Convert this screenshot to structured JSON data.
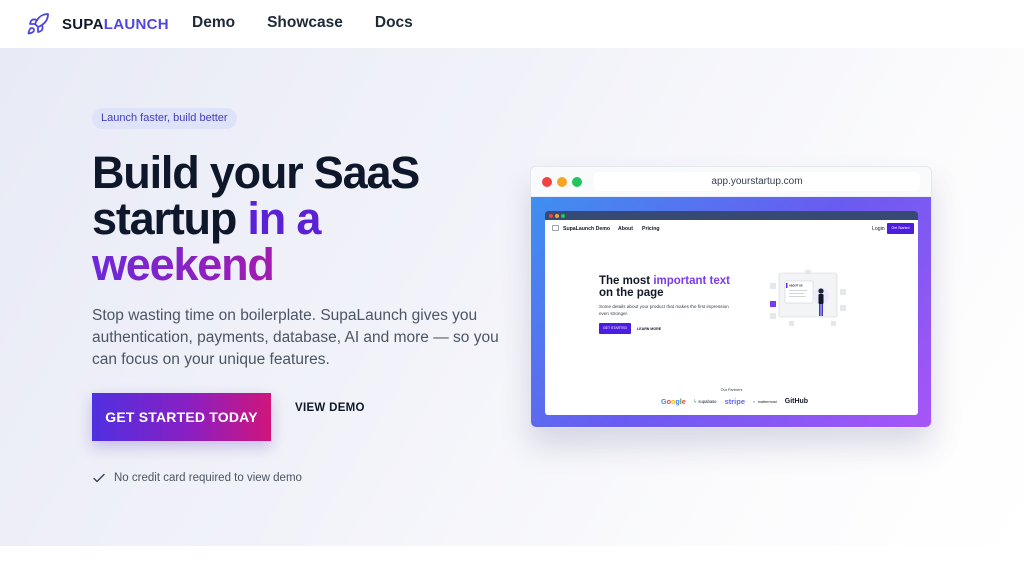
{
  "nav": {
    "brand_part1": "SUPA",
    "brand_part2": "LAUNCH",
    "links": [
      "Demo",
      "Showcase",
      "Docs"
    ],
    "logo_icon": "rocket-icon"
  },
  "hero": {
    "badge": "Launch faster, build better",
    "headline_plain": "Build your SaaS startup ",
    "headline_accent1": "in a",
    "headline_accent2": "weekend",
    "subtext": "Stop wasting time on boilerplate. SupaLaunch gives you authentication, payments, database, AI and more — so you can focus on your unique features.",
    "cta_primary": "GET STARTED TODAY",
    "cta_secondary": "VIEW DEMO",
    "note": "No credit card required to view demo"
  },
  "mockup": {
    "url": "app.yourstartup.com",
    "nav_brand": "SupaLaunch Demo",
    "nav_about": "About",
    "nav_pricing": "Pricing",
    "nav_login": "Login",
    "nav_cta": "Get Started",
    "headline_part1": "The most ",
    "headline_highlight": "important text",
    "headline_part2": "on the page",
    "description": "Some details about your product that makes the first impression even stronger.",
    "cta_primary": "GET STARTED",
    "cta_secondary": "LEARN MORE",
    "illustration_text": "ABOUT US",
    "partners_label": "Our Partners",
    "partners": {
      "google": [
        "G",
        "o",
        "o",
        "g",
        "l",
        "e"
      ],
      "supabase": "supabase",
      "stripe": "stripe",
      "mattermost": "mattermost",
      "github": "GitHub"
    }
  },
  "colors": {
    "accent": "#4f46e5",
    "headline_purple": "#5b21d6",
    "cta_gradient_start": "#4f30e0",
    "cta_gradient_end": "#d0157a"
  }
}
